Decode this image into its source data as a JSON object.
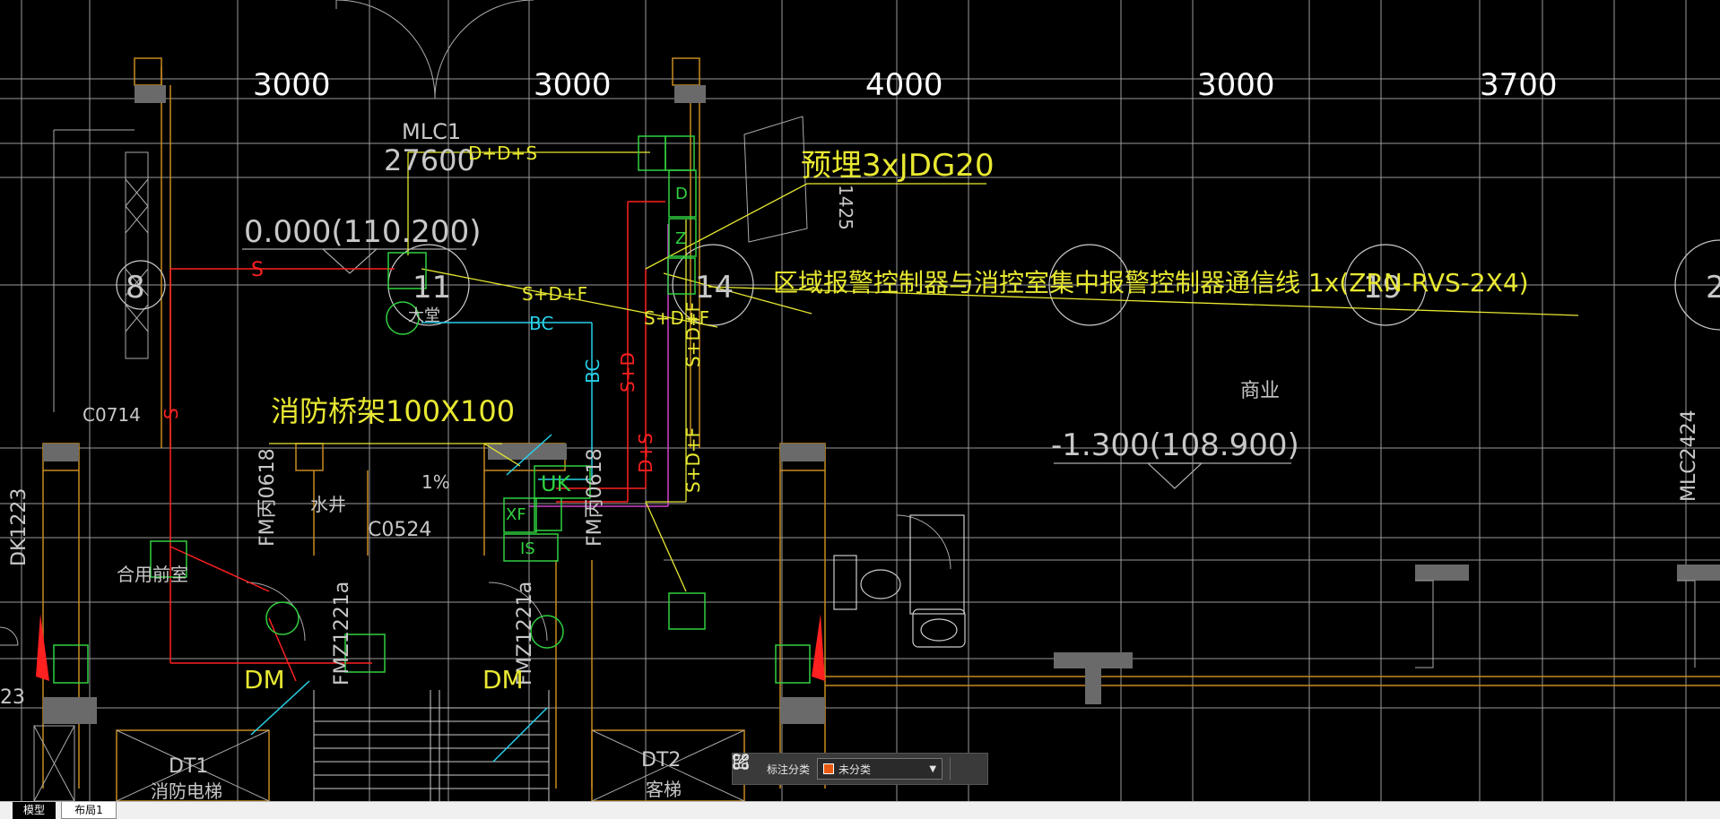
{
  "drawing": {
    "dimensions": [
      "3000",
      "3000",
      "4000",
      "3000",
      "3700"
    ],
    "door_tag_main": "MLC1",
    "area_code": "27600",
    "elevation_upper": "0.000(110.200)",
    "elevation_lower": "-1.300(108.900)",
    "pipe_label": "预埋3xJDG20",
    "comm_line_label": "区域报警控制器与消控室集中报警控制器通信线 1x(ZRN-RVS-2X4)",
    "tray_label": "消防桥架100X100",
    "room_commercial": "商业",
    "room_water_well": "水井",
    "room_hall": "大堂",
    "room_shared_front": "合用前室",
    "window_tag_left": "C0714",
    "window_tag_mid": "C0524",
    "door_tag_fm1": "FM丙0618",
    "door_tag_fm2": "FM丙0618",
    "door_tag_fmz1": "FMZ1221a",
    "door_tag_fmz2": "FMZ1221a",
    "door_tag_dk": "DK1223",
    "door_tag_mlc2424": "MLC2424",
    "door_tag_425": "1425",
    "elevator_dt1": "DT1",
    "elevator_dt1_name": "消防电梯",
    "elevator_dt2": "DT2",
    "elevator_dt2_name": "客梯",
    "axis_8": "8",
    "axis_11": "11",
    "axis_14": "14",
    "axis_19": "19",
    "axis_2": "2",
    "line_s": "S",
    "line_s2": "S",
    "line_dds": "D+D+S",
    "line_sdf1": "S+D+F",
    "line_sdf2": "S+D+F",
    "line_sdf_v1": "S+D+F",
    "line_sdf_v2": "S+D+F",
    "line_bc": "BC",
    "line_bc_v": "BC",
    "line_sd_v": "S+D",
    "line_ds_v": "D+S",
    "box_d": "D",
    "box_z": "Z",
    "box_uk": "UK",
    "box_xf": "XF",
    "box_is": "IS",
    "tag_dm1": "DM",
    "tag_dm2": "DM",
    "slope": "1%",
    "edge_23": "23"
  },
  "toolbar": {
    "label": "标注分类",
    "selected": "未分类",
    "swatch_color": "#e85a10"
  },
  "tabs": [
    {
      "label": "模型",
      "active": true
    },
    {
      "label": "布局1",
      "active": false
    }
  ],
  "colors": {
    "background": "#000000",
    "wall_orange": "#c88a20",
    "grid_gray": "#8a8a8a",
    "device_green": "#30d040",
    "wire_yellow": "#e8e832",
    "wire_red": "#ff2020",
    "wire_cyan": "#27d0e8",
    "wire_magenta": "#d040d0"
  }
}
